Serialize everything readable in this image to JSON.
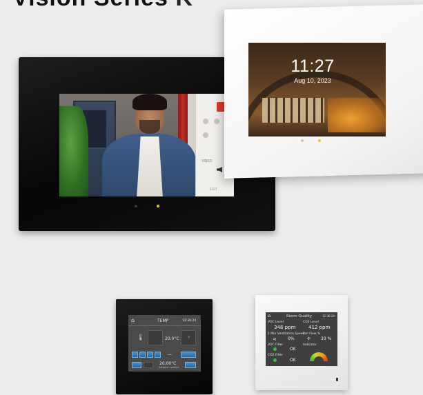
{
  "heading": {
    "text_a": "Visio",
    "text_b": "n Se",
    "text_c": "ri",
    "text_d": "es",
    "text_e": "K"
  },
  "intercom": {
    "side_label": "VIDEO",
    "side_bottom": "EXIT",
    "dot_colors": [
      "#3a3a3a",
      "#e8c21e"
    ]
  },
  "clock_panel": {
    "time": "11:27",
    "date": "Aug 10, 2023",
    "dot_colors": [
      "#c8c8c8",
      "#f0c419"
    ]
  },
  "thermostat": {
    "title": "TEMP",
    "clock": "12:36:24",
    "current_temp": "20.0°C",
    "mode_symbol": "—",
    "setpoint": "20.00°C",
    "setpoint_caption": "Setpoint comfort"
  },
  "room_quality": {
    "title": "Room Quality",
    "clock": "12:36:24",
    "voc_label": "VOC Level",
    "voc_value": "348 ppm",
    "co2_label": "CO2 Level",
    "co2_value": "412 ppm",
    "ventilation_label": "1 Min Ventilation Speed",
    "ventilation_value": "0%",
    "fan_label": "Fan Flow %",
    "fan_value": "33 %",
    "voc_filter_label": "VOC Filter",
    "voc_filter_value": "OK",
    "indicator_label": "Indicator",
    "co2_filter_label": "CO2 Filter",
    "co2_filter_value": "OK"
  }
}
